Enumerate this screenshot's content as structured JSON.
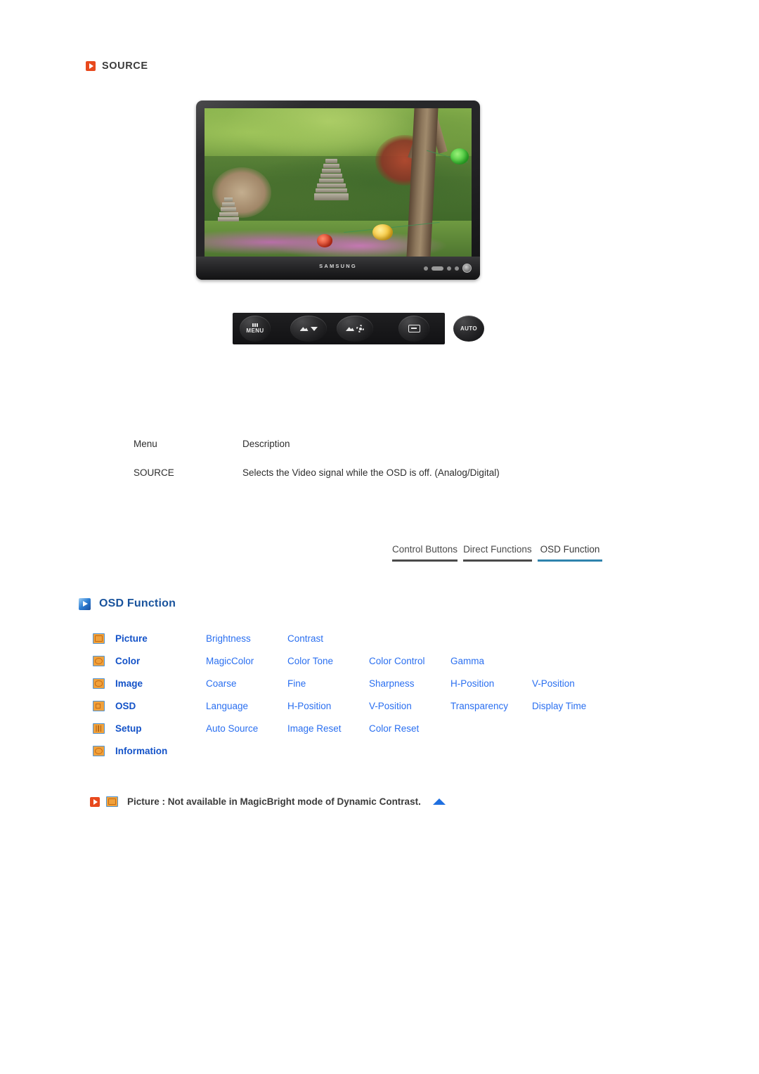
{
  "page": {
    "section_heading": {
      "icon": "arrow-right-orange-icon",
      "label": "SOURCE"
    }
  },
  "monitor": {
    "brand": "SAMSUNG",
    "scene_description": "Garden with stone pagoda, trees and paper lanterns"
  },
  "control_buttons": [
    {
      "name": "menu-button",
      "label": "MENU",
      "icon": "menu-bars-icon"
    },
    {
      "name": "adjust-button",
      "label": "",
      "icon": "mountain-caret-down-icon"
    },
    {
      "name": "brightness-button",
      "label": "",
      "icon": "mountain-sun-icon"
    },
    {
      "name": "source-enter-button",
      "label": "",
      "icon": "enter-source-icon"
    },
    {
      "name": "auto-button",
      "label": "AUTO",
      "icon": "auto-text-icon"
    }
  ],
  "description_table": {
    "headers": {
      "menu": "Menu",
      "description": "Description"
    },
    "rows": [
      {
        "menu": "SOURCE",
        "description": "Selects the Video signal while the OSD is off. (Analog/Digital)"
      }
    ]
  },
  "tabs": [
    {
      "label": "Control Buttons",
      "active": false
    },
    {
      "label": "Direct Functions",
      "active": false
    },
    {
      "label": "OSD Function",
      "active": true
    }
  ],
  "osd_function": {
    "heading": "OSD Function",
    "heading_icon": "arrow-right-blue-icon",
    "rows": [
      {
        "icon": "picture-icon",
        "label": "Picture",
        "items": [
          "Brightness",
          "Contrast"
        ]
      },
      {
        "icon": "color-icon",
        "label": "Color",
        "items": [
          "MagicColor",
          "Color Tone",
          "Color Control",
          "Gamma"
        ]
      },
      {
        "icon": "image-icon",
        "label": "Image",
        "items": [
          "Coarse",
          "Fine",
          "Sharpness",
          "H-Position",
          "V-Position"
        ]
      },
      {
        "icon": "osd-icon",
        "label": "OSD",
        "items": [
          "Language",
          "H-Position",
          "V-Position",
          "Transparency",
          "Display Time"
        ]
      },
      {
        "icon": "setup-icon",
        "label": "Setup",
        "items": [
          "Auto Source",
          "Image Reset",
          "Color Reset"
        ]
      },
      {
        "icon": "information-icon",
        "label": "Information",
        "items": []
      }
    ]
  },
  "footnote": {
    "bullet_icon": "arrow-right-orange-icon",
    "badge_icon": "picture-icon",
    "text": "Picture : Not available in MagicBright mode of Dynamic Contrast.",
    "top_icon": "arrow-up-blue-icon"
  },
  "colors": {
    "orange_accent": "#e8491d",
    "blue_heading": "#19539c",
    "blue_link": "#2a6ff0",
    "blue_label": "#1352c8",
    "tab_active_underline": "#2f83ad",
    "tab_underline": "#4a4a4a",
    "icon_fill": "#f0a13c",
    "icon_border": "#4f96d8"
  }
}
